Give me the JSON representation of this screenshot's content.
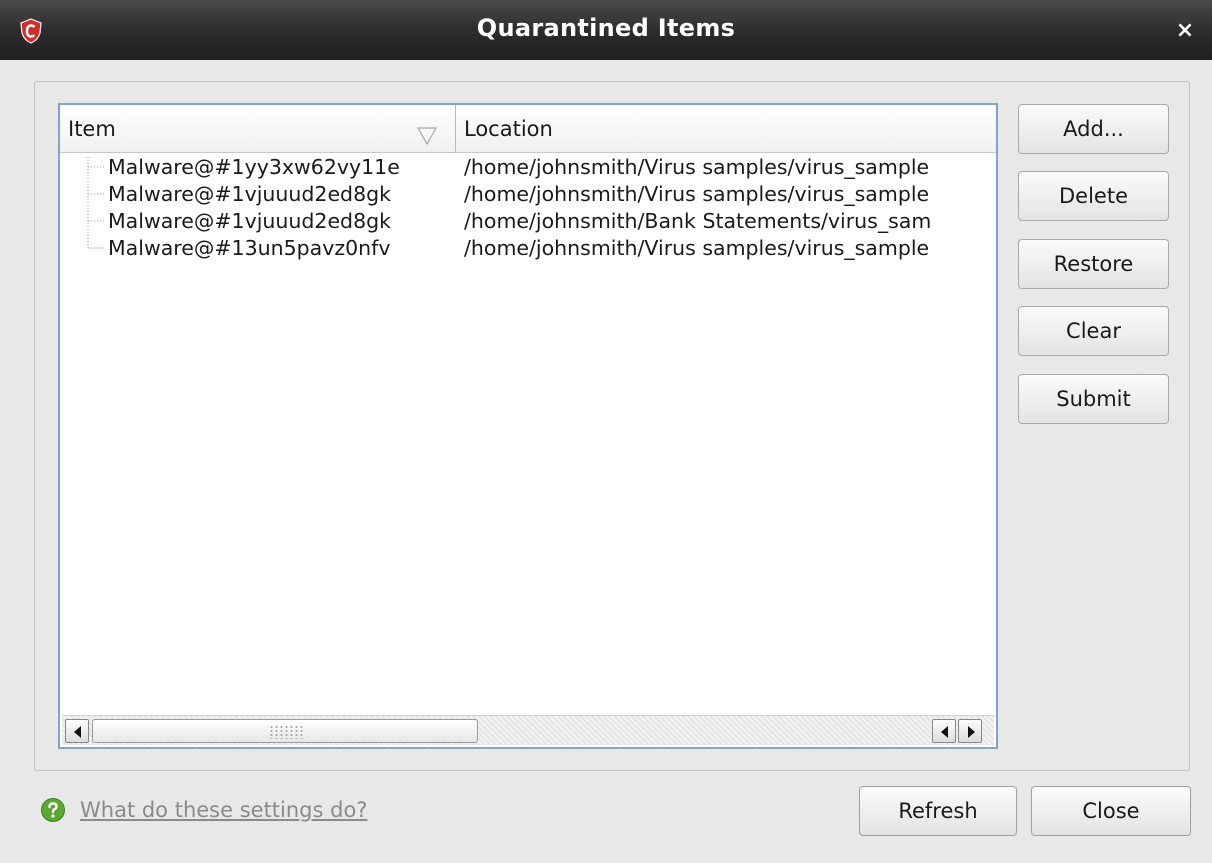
{
  "window": {
    "title": "Quarantined Items",
    "close_glyph": "×",
    "app_icon": "comodo-shield-icon"
  },
  "table": {
    "columns": [
      "Item",
      "Location"
    ],
    "sort_icon": "sort-descending-triangle-icon",
    "rows": [
      {
        "item": "Malware@#1yy3xw62vy11e",
        "location": "/home/johnsmith/Virus samples/virus_sample"
      },
      {
        "item": "Malware@#1vjuuud2ed8gk",
        "location": "/home/johnsmith/Virus samples/virus_sample"
      },
      {
        "item": "Malware@#1vjuuud2ed8gk",
        "location": "/home/johnsmith/Bank Statements/virus_sam"
      },
      {
        "item": "Malware@#13un5pavz0nfv",
        "location": "/home/johnsmith/Virus samples/virus_sample"
      }
    ]
  },
  "side_buttons": {
    "add": "Add...",
    "delete": "Delete",
    "restore": "Restore",
    "clear": "Clear",
    "submit": "Submit"
  },
  "footer": {
    "help_link": "What do these settings do?",
    "help_icon": "question-mark-green-icon",
    "refresh": "Refresh",
    "close": "Close"
  },
  "colors": {
    "titlebar": "#2b2b2b",
    "list_border": "#7fa4cf",
    "app_icon_red": "#d42b2b",
    "help_icon_green": "#5aa832"
  }
}
